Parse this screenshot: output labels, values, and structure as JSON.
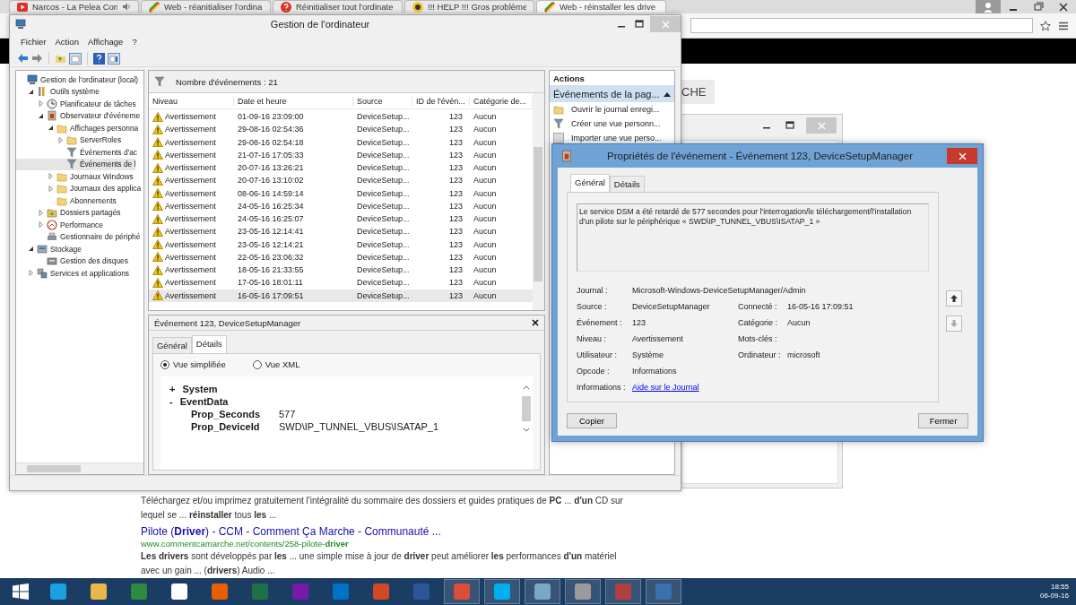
{
  "browser": {
    "tabs": [
      {
        "title": "Narcos - La Pelea Con",
        "kind": "video",
        "audio": true,
        "selected": false
      },
      {
        "title": "Web - réanitialiser l'ordina",
        "kind": "web",
        "audio": false,
        "selected": false
      },
      {
        "title": "Réinitialiser tout l'ordinate",
        "kind": "help",
        "audio": false,
        "selected": false
      },
      {
        "title": "!!! HELP !!! Gros problème",
        "kind": "hazard",
        "audio": false,
        "selected": false
      },
      {
        "title": "Web - réinstaller les drive",
        "kind": "web",
        "audio": false,
        "selected": true
      }
    ],
    "page_button": "CHE",
    "results": [
      {
        "snippet": "Téléchargez et/ou imprimez gratuitement l'intégralité du sommaire des dossiers et guides pratiques de **PC** ... **d'un** CD sur lequel se ... **réinstaller** tous **les** ..."
      },
      {
        "title": "Pilote (**Driver**) - CCM - Comment Ça Marche - Communauté ...",
        "url": "www.commentcamarche.net/contents/258-pilote-**driver**",
        "snippet": "**Les drivers** sont développés par **les** ... une simple mise à jour de **driver** peut améliorer **les** performances **d'un** matériel avec un gain ... (**drivers**) Audio ..."
      }
    ]
  },
  "mmc": {
    "title": "Gestion de l'ordinateur",
    "menu": [
      "Fichier",
      "Action",
      "Affichage",
      "?"
    ],
    "tree": [
      {
        "label": "Gestion de l'ordinateur (local)",
        "kind": "computer",
        "selected": false,
        "children": [
          {
            "label": "Outils système",
            "kind": "tools",
            "expanded": true,
            "selected": false,
            "children": [
              {
                "label": "Planificateur de tâches",
                "kind": "clock",
                "expanded": false,
                "selected": false
              },
              {
                "label": "Observateur d'événeme",
                "kind": "log",
                "expanded": true,
                "selected": false,
                "children": [
                  {
                    "label": "Affichages personna",
                    "kind": "folder",
                    "expanded": true,
                    "selected": false,
                    "children": [
                      {
                        "label": "ServerRoles",
                        "kind": "folder",
                        "expanded": false,
                        "selected": false
                      },
                      {
                        "label": "Événements d'ac",
                        "kind": "filter",
                        "selected": false
                      },
                      {
                        "label": "Événements de l",
                        "kind": "filter",
                        "selected": true
                      }
                    ]
                  },
                  {
                    "label": "Journaux Windows",
                    "kind": "folder",
                    "expanded": false,
                    "selected": false
                  },
                  {
                    "label": "Journaux des applica",
                    "kind": "folder",
                    "expanded": false,
                    "selected": false
                  },
                  {
                    "label": "Abonnements",
                    "kind": "folder",
                    "selected": false
                  }
                ]
              },
              {
                "label": "Dossiers partagés",
                "kind": "share",
                "expanded": false,
                "selected": false
              },
              {
                "label": "Performance",
                "kind": "perf",
                "expanded": false,
                "selected": false
              },
              {
                "label": "Gestionnaire de périphé",
                "kind": "device",
                "selected": false
              }
            ]
          },
          {
            "label": "Stockage",
            "kind": "storage",
            "expanded": true,
            "selected": false,
            "children": [
              {
                "label": "Gestion des disques",
                "kind": "disk",
                "selected": false
              }
            ]
          },
          {
            "label": "Services et applications",
            "kind": "services",
            "expanded": false,
            "selected": false
          }
        ]
      }
    ],
    "events": {
      "count_label": "Nombre d'événements : 21",
      "columns": [
        "Niveau",
        "Date et heure",
        "Source",
        "ID de l'évén...",
        "Catégorie de..."
      ],
      "rows": [
        {
          "level": "Avertissement",
          "date": "01-09-16 23:09:00",
          "source": "DeviceSetup...",
          "id": "123",
          "category": "Aucun",
          "selected": false
        },
        {
          "level": "Avertissement",
          "date": "29-08-16 02:54:36",
          "source": "DeviceSetup...",
          "id": "123",
          "category": "Aucun",
          "selected": false
        },
        {
          "level": "Avertissement",
          "date": "29-08-16 02:54:18",
          "source": "DeviceSetup...",
          "id": "123",
          "category": "Aucun",
          "selected": false
        },
        {
          "level": "Avertissement",
          "date": "21-07-16 17:05:33",
          "source": "DeviceSetup...",
          "id": "123",
          "category": "Aucun",
          "selected": false
        },
        {
          "level": "Avertissement",
          "date": "20-07-16 13:26:21",
          "source": "DeviceSetup...",
          "id": "123",
          "category": "Aucun",
          "selected": false
        },
        {
          "level": "Avertissement",
          "date": "20-07-16 13:10:02",
          "source": "DeviceSetup...",
          "id": "123",
          "category": "Aucun",
          "selected": false
        },
        {
          "level": "Avertissement",
          "date": "08-06-16 14:59:14",
          "source": "DeviceSetup...",
          "id": "123",
          "category": "Aucun",
          "selected": false
        },
        {
          "level": "Avertissement",
          "date": "24-05-16 16:25:34",
          "source": "DeviceSetup...",
          "id": "123",
          "category": "Aucun",
          "selected": false
        },
        {
          "level": "Avertissement",
          "date": "24-05-16 16:25:07",
          "source": "DeviceSetup...",
          "id": "123",
          "category": "Aucun",
          "selected": false
        },
        {
          "level": "Avertissement",
          "date": "23-05-16 12:14:41",
          "source": "DeviceSetup...",
          "id": "123",
          "category": "Aucun",
          "selected": false
        },
        {
          "level": "Avertissement",
          "date": "23-05-16 12:14:21",
          "source": "DeviceSetup...",
          "id": "123",
          "category": "Aucun",
          "selected": false
        },
        {
          "level": "Avertissement",
          "date": "22-05-16 23:06:32",
          "source": "DeviceSetup...",
          "id": "123",
          "category": "Aucun",
          "selected": false
        },
        {
          "level": "Avertissement",
          "date": "18-05-16 21:33:55",
          "source": "DeviceSetup...",
          "id": "123",
          "category": "Aucun",
          "selected": false
        },
        {
          "level": "Avertissement",
          "date": "17-05-16 18:01:11",
          "source": "DeviceSetup...",
          "id": "123",
          "category": "Aucun",
          "selected": false
        },
        {
          "level": "Avertissement",
          "date": "16-05-16 17:09:51",
          "source": "DeviceSetup...",
          "id": "123",
          "category": "Aucun",
          "selected": true
        }
      ]
    },
    "detail": {
      "title": "Événement 123, DeviceSetupManager",
      "tabs": [
        {
          "label": "Général",
          "selected": false
        },
        {
          "label": "Détails",
          "selected": true
        }
      ],
      "views": [
        {
          "label": "Vue simplifiée",
          "selected": true
        },
        {
          "label": "Vue XML",
          "selected": false
        }
      ],
      "sections": [
        {
          "sign": "+",
          "label": "System"
        },
        {
          "sign": "-",
          "label": "EventData",
          "props": [
            {
              "name": "Prop_Seconds",
              "value": "577"
            },
            {
              "name": "Prop_DeviceId",
              "value": "SWD\\IP_TUNNEL_VBUS\\ISATAP_1"
            }
          ]
        }
      ]
    },
    "actions": {
      "title": "Actions",
      "section": "Événements de la pag...",
      "items": [
        {
          "label": "Ouvrir le journal enregi...",
          "kind": "open"
        },
        {
          "label": "Créer une vue personn...",
          "kind": "filter"
        },
        {
          "label": "Importer une vue perso...",
          "kind": "import"
        }
      ]
    }
  },
  "dialog": {
    "title": "Propriétés de l'événement - Événement 123, DeviceSetupManager",
    "tabs": [
      {
        "label": "Général",
        "selected": true
      },
      {
        "label": "Détails",
        "selected": false
      }
    ],
    "description": "Le service DSM a été retardé de 577 secondes pour l'interrogation/le téléchargement/l'installation d'un pilote sur le périphérique « SWD\\IP_TUNNEL_VBUS\\ISATAP_1 »",
    "fields": [
      [
        {
          "label": "Journal :",
          "value": "Microsoft-Windows-DeviceSetupManager/Admin"
        }
      ],
      [
        {
          "label": "Source :",
          "value": "DeviceSetupManager"
        },
        {
          "label": "Connecté :",
          "value": "16-05-16 17:09:51"
        }
      ],
      [
        {
          "label": "Événement :",
          "value": "123"
        },
        {
          "label": "Catégorie :",
          "value": "Aucun"
        }
      ],
      [
        {
          "label": "Niveau :",
          "value": "Avertissement"
        },
        {
          "label": "Mots-clés :"
        }
      ],
      [
        {
          "label": "Utilisateur :",
          "value": "Système"
        },
        {
          "label": "Ordinateur :",
          "value": "microsoft"
        }
      ],
      [
        {
          "label": "Opcode :",
          "value": "Informations"
        }
      ],
      [
        {
          "label": "Informations :",
          "value": "Aide sur le Journal",
          "kind": "link"
        }
      ]
    ],
    "nav": [
      {
        "kind": "up",
        "disabled": false
      },
      {
        "kind": "down",
        "disabled": true
      }
    ],
    "buttons": [
      "Copier",
      "Fermer"
    ]
  },
  "taskbar": {
    "apps": [
      {
        "color": "#1ba1e2",
        "running": false
      },
      {
        "color": "#e8b64a",
        "running": false
      },
      {
        "color": "#2e8b3e",
        "running": false
      },
      {
        "color": "#ffffff",
        "running": false
      },
      {
        "color": "#e66000",
        "running": false
      },
      {
        "color": "#1e7145",
        "running": false
      },
      {
        "color": "#7719aa",
        "running": false
      },
      {
        "color": "#0072c6",
        "running": false
      },
      {
        "color": "#d24726",
        "running": false
      },
      {
        "color": "#2b579a",
        "running": false
      },
      {
        "color": "#dd4b39",
        "running": true
      },
      {
        "color": "#00aff0",
        "running": true
      },
      {
        "color": "#7aa6c8",
        "running": true
      },
      {
        "color": "#9a9a9a",
        "running": true
      },
      {
        "color": "#b04040",
        "running": true
      },
      {
        "color": "#3a6fb0",
        "running": true
      }
    ],
    "time": "18:55",
    "date": "06-09-16"
  }
}
